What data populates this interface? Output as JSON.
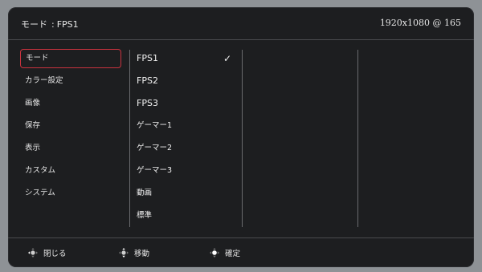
{
  "header": {
    "mode_label": "モード",
    "separator": ":",
    "mode_value": "FPS1",
    "resolution": "1920x1080 @ 165"
  },
  "sidebar": {
    "items": [
      {
        "label": "モード",
        "active": true
      },
      {
        "label": "カラー設定",
        "active": false
      },
      {
        "label": "画像",
        "active": false
      },
      {
        "label": "保存",
        "active": false
      },
      {
        "label": "表示",
        "active": false
      },
      {
        "label": "カスタム",
        "active": false
      },
      {
        "label": "システム",
        "active": false
      }
    ]
  },
  "options": {
    "items": [
      {
        "label": "FPS1",
        "selected": true
      },
      {
        "label": "FPS2",
        "selected": false
      },
      {
        "label": "FPS3",
        "selected": false
      },
      {
        "label": "ゲーマー1",
        "selected": false
      },
      {
        "label": "ゲーマー2",
        "selected": false
      },
      {
        "label": "ゲーマー3",
        "selected": false
      },
      {
        "label": "動画",
        "selected": false
      },
      {
        "label": "標準",
        "selected": false
      }
    ],
    "check_glyph": "✓"
  },
  "footer": {
    "close_label": "閉じる",
    "move_label": "移動",
    "confirm_label": "確定"
  },
  "colors": {
    "panel": "#1d1e20",
    "accent_border": "#c9323e",
    "text": "#e8e8e8",
    "divider": "#6a6b6e"
  },
  "icons": {
    "close": "joystick-left-icon",
    "move": "joystick-updown-icon",
    "confirm": "joystick-press-icon",
    "selected": "check-icon"
  }
}
